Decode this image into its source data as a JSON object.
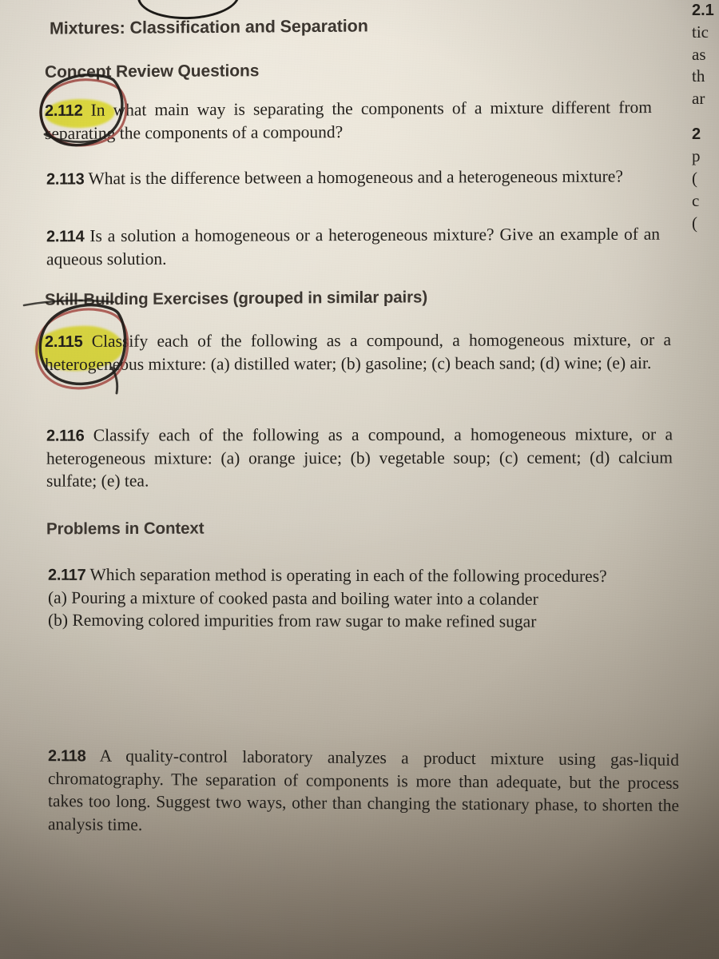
{
  "page": {
    "medium": "photograph of a printed chemistry textbook page",
    "paper_color": "#ded8cb",
    "ink_color": "#23201c",
    "heading_color": "#3c3630",
    "highlighter_color": "#eff03a",
    "red_pen_color": "#a04a44",
    "black_pen_color": "#1c1a17"
  },
  "headings": {
    "running_head": "Mixtures: Classification and Separation",
    "concept_review": "Concept Review Questions",
    "skill_building": "Skill-Building Exercises (grouped in similar pairs)",
    "problems_in_context": "Problems in Context"
  },
  "questions": [
    {
      "number": "2.112",
      "text": "In what main way is separating the components of a mixture different from separating the components of a compound?",
      "annotated": true
    },
    {
      "number": "2.113",
      "text": "What is the difference between a homogeneous and a heterogeneous mixture?",
      "annotated": false
    },
    {
      "number": "2.114",
      "text": "Is a solution a homogeneous or a heterogeneous mixture? Give an example of an aqueous solution.",
      "annotated": false
    },
    {
      "number": "2.115",
      "text": "Classify each of the following as a compound, a homogeneous mixture, or a heterogeneous mixture: (a) distilled water; (b) gasoline; (c) beach sand; (d) wine; (e) air.",
      "annotated": true
    },
    {
      "number": "2.116",
      "text": "Classify each of the following as a compound, a homogeneous mixture, or a heterogeneous mixture: (a) orange juice; (b) vegetable soup; (c) cement; (d) calcium sulfate; (e) tea.",
      "annotated": false
    },
    {
      "number": "2.117",
      "text": "Which separation method is operating in each of the following procedures?",
      "annotated": false,
      "subparts": [
        "(a) Pouring a mixture of cooked pasta and boiling water into a colander",
        "(b) Removing colored impurities from raw sugar to make refined sugar"
      ]
    },
    {
      "number": "2.118",
      "text": "A quality-control laboratory analyzes a product mixture using gas-liquid chromatography. The separation of components is more than adequate, but the process takes too long. Suggest two ways, other than changing the stationary phase, to shorten the analysis time.",
      "annotated": false
    }
  ],
  "cut_off_right_column": {
    "description": "Adjacent text column clipped by the right edge of the photograph",
    "upper_fragments": [
      "2.1",
      "tic",
      "as",
      "th",
      "ar"
    ],
    "lower_fragments": [
      "2",
      "p",
      "(",
      "c",
      "("
    ]
  },
  "annotations": [
    {
      "target": "2.112",
      "marks": [
        "yellow-highlight",
        "black-pen-circle",
        "red-pen-circle"
      ]
    },
    {
      "target": "2.115",
      "marks": [
        "yellow-highlight",
        "black-pen-circle",
        "red-pen-circle"
      ]
    },
    {
      "target": "page-top-edge",
      "marks": [
        "black-pen-arc"
      ]
    }
  ]
}
